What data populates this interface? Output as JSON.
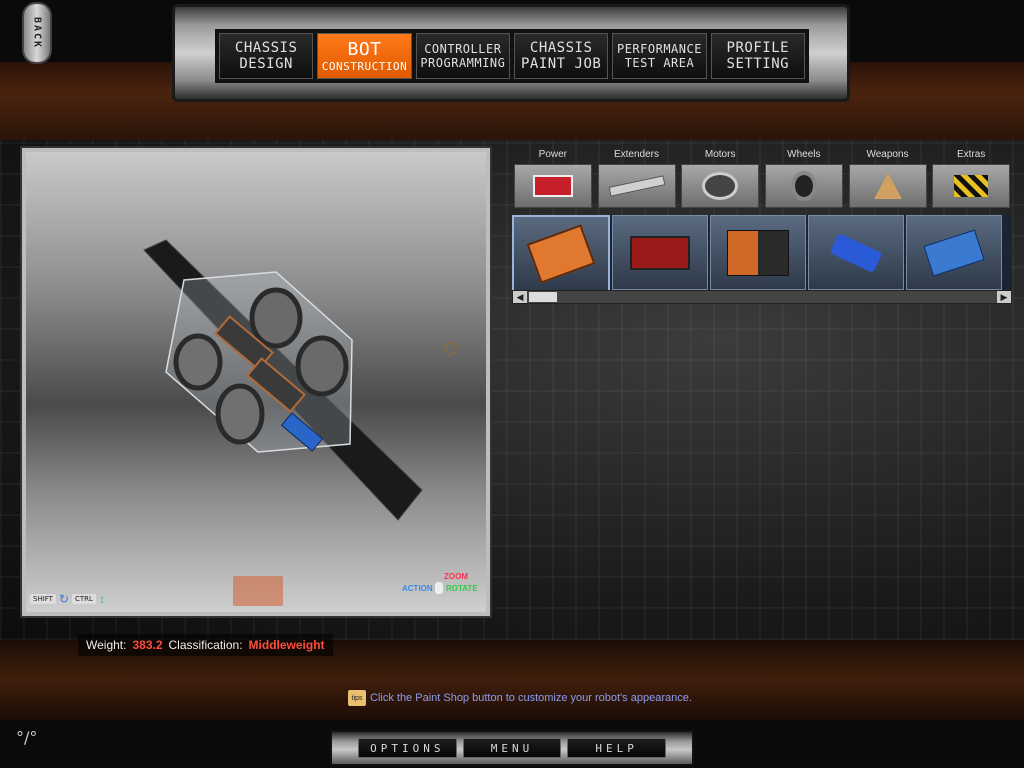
{
  "back": {
    "label": "BACK"
  },
  "topnav": {
    "tabs": [
      {
        "line1": "CHASSIS",
        "line2": "DESIGN"
      },
      {
        "line1": "BOT",
        "line2": "CONSTRUCTION"
      },
      {
        "line1": "CONTROLLER",
        "line2": "PROGRAMMING"
      },
      {
        "line1": "CHASSIS",
        "line2": "PAINT JOB"
      },
      {
        "line1": "PERFORMANCE",
        "line2": "TEST AREA"
      },
      {
        "line1": "PROFILE",
        "line2": "SETTING"
      }
    ],
    "active": "BOT CONSTRUCTION"
  },
  "viewport": {
    "shift_key": "SHIFT",
    "ctrl_key": "CTRL",
    "zoom_label": "ZOOM",
    "action_label": "ACTION",
    "rotate_label": "ROTATE"
  },
  "categories": [
    {
      "label": "Power",
      "icon": "battery-icon"
    },
    {
      "label": "Extenders",
      "icon": "bar-icon"
    },
    {
      "label": "Motors",
      "icon": "motor-icon"
    },
    {
      "label": "Wheels",
      "icon": "wheel-icon"
    },
    {
      "label": "Weapons",
      "icon": "blade-icon"
    },
    {
      "label": "Extras",
      "icon": "hazard-icon"
    }
  ],
  "parts": [
    {
      "icon": "orange-battery-pack-icon"
    },
    {
      "icon": "red-battery-icon"
    },
    {
      "icon": "battery-cluster-icon"
    },
    {
      "icon": "blue-power-cell-icon"
    },
    {
      "icon": "blue-battery-box-icon"
    }
  ],
  "status": {
    "weight_label": "Weight:",
    "weight_value": "383.2",
    "class_label": "Classification:",
    "class_value": "Middleweight"
  },
  "tip": {
    "badge": "tips",
    "text": "Click the Paint Shop button to customize your robot's appearance."
  },
  "bottom": {
    "options": "OPTIONS",
    "menu": "MENU",
    "help": "HELP"
  },
  "colors": {
    "accent": "#ff6a00",
    "value_red": "#ff4d3d",
    "tip_text": "#8e9cf0"
  }
}
